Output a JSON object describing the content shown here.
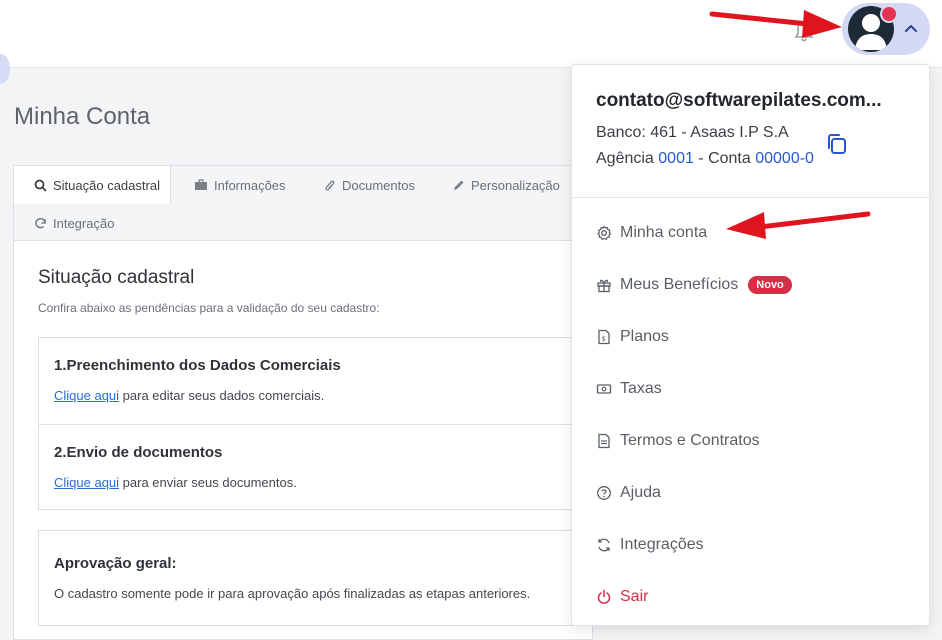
{
  "header": {
    "notification_icon": "bell-icon",
    "avatar_icon": "user-avatar-icon",
    "toggle_icon": "chevron-up-icon"
  },
  "page": {
    "title": "Minha Conta"
  },
  "tabs": [
    {
      "label": "Situação cadastral",
      "icon": "search-icon",
      "active": true
    },
    {
      "label": "Informações",
      "icon": "briefcase-icon",
      "active": false
    },
    {
      "label": "Documentos",
      "icon": "paperclip-icon",
      "active": false
    },
    {
      "label": "Personalização",
      "icon": "pencil-icon",
      "active": false
    },
    {
      "label": "Integração",
      "icon": "refresh-icon",
      "active": false
    }
  ],
  "section": {
    "title": "Situação cadastral",
    "subtitle": "Confira abaixo as pendências para a validação do seu cadastro:",
    "steps": [
      {
        "title": "1.Preenchimento dos Dados Comerciais",
        "link": "Clique aqui",
        "text": " para editar seus dados comerciais."
      },
      {
        "title": "2.Envio de documentos",
        "link": "Clique aqui",
        "text": " para enviar seus documentos."
      }
    ],
    "approval": {
      "title": "Aprovação geral:",
      "text": "O cadastro somente pode ir para aprovação após finalizadas as etapas anteriores."
    }
  },
  "dropdown": {
    "email": "contato@softwarepilates.com...",
    "bank": "Banco: 461 - Asaas I.P S.A",
    "agency_label": "Agência ",
    "agency": "0001",
    "account_label": " - Conta ",
    "account": "00000-0",
    "copy_icon": "copy-icon",
    "items": [
      {
        "label": "Minha conta",
        "icon": "gear-icon"
      },
      {
        "label": "Meus Benefícios",
        "icon": "gift-icon",
        "badge": "Novo"
      },
      {
        "label": "Planos",
        "icon": "document-dollar-icon"
      },
      {
        "label": "Taxas",
        "icon": "money-icon"
      },
      {
        "label": "Termos e Contratos",
        "icon": "document-icon"
      },
      {
        "label": "Ajuda",
        "icon": "help-circle-icon"
      },
      {
        "label": "Integrações",
        "icon": "sync-icon"
      },
      {
        "label": "Sair",
        "icon": "power-icon"
      }
    ]
  },
  "colors": {
    "accent_blue": "#2956d1",
    "danger_red": "#d32f45",
    "annotation_arrow": "#e0141e"
  }
}
